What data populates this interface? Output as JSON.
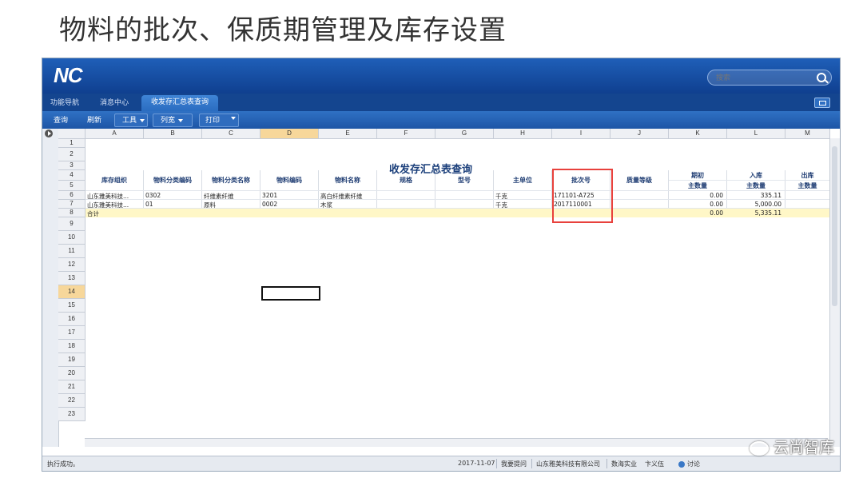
{
  "slide_title": "物料的批次、保质期管理及库存设置",
  "app": {
    "logo": "NC",
    "search_placeholder": "搜索",
    "tabs": [
      "功能导航",
      "消息中心",
      "收发存汇总表查询"
    ],
    "toolbar": {
      "query": "查询",
      "refresh": "刷新",
      "tools": "工具",
      "layout": "列宽",
      "print": "打印"
    }
  },
  "sheet": {
    "columns": [
      "A",
      "B",
      "C",
      "D",
      "E",
      "F",
      "G",
      "H",
      "I",
      "J",
      "K",
      "L",
      "M"
    ],
    "rows": [
      "1",
      "2",
      "3",
      "4",
      "5",
      "6",
      "7",
      "8",
      "9",
      "10",
      "11",
      "12",
      "13",
      "14",
      "15",
      "16",
      "17",
      "18",
      "19",
      "20",
      "21",
      "22",
      "23"
    ],
    "report_title": "收发存汇总表查询",
    "headers": {
      "a": "库存组织",
      "b": "物料分类编码",
      "c": "物料分类名称",
      "d": "物料编码",
      "e": "物料名称",
      "f": "规格",
      "g": "型号",
      "h": "主单位",
      "i": "批次号",
      "j": "质量等级",
      "k_top": "期初",
      "k_sub": "主数量",
      "l_top": "入库",
      "l_sub": "主数量",
      "m_top": "出库",
      "m_sub": "主数量"
    },
    "data_rows": [
      {
        "org": "山东雅美科技...",
        "cat_code": "0302",
        "cat_name": "纤维素纤维",
        "code": "3201",
        "name": "高白纤维素纤维",
        "unit": "千克",
        "batch": "171101-A725",
        "opening": "0.00",
        "in": "335.11"
      },
      {
        "org": "山东雅美科技...",
        "cat_code": "01",
        "cat_name": "原料",
        "code": "0002",
        "name": "木浆",
        "unit": "千克",
        "batch": "2017110001",
        "opening": "0.00",
        "in": "5,000.00"
      }
    ],
    "total": {
      "label": "合计",
      "opening": "0.00",
      "in": "5,335.11"
    }
  },
  "status": {
    "left": "执行成功。",
    "date": "2017-11-07",
    "hint": "我要提问",
    "company": "山东雅美科技有限公司",
    "dept": "数海实业",
    "user": "卞义伍",
    "discuss": "讨论"
  },
  "watermark": "云尚智库"
}
